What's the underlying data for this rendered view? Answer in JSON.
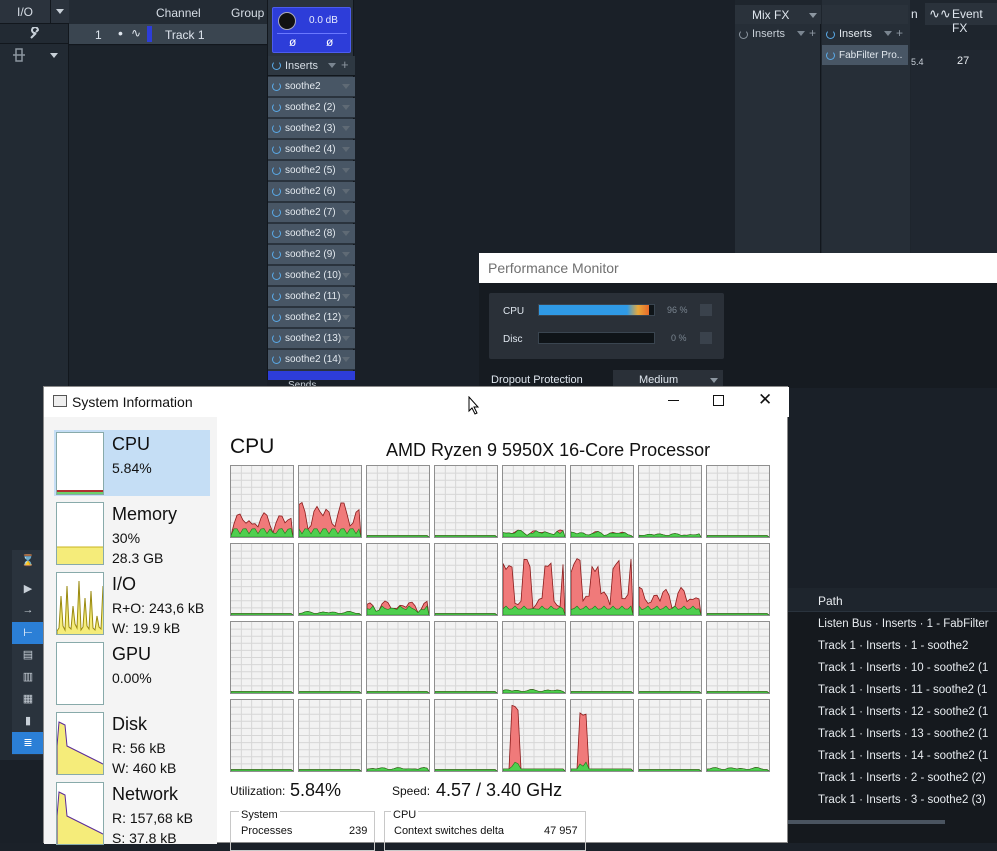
{
  "daw": {
    "io_label": "I/O",
    "channel_header": "Channel",
    "group_header": "Group",
    "track_number": "1",
    "track_name": "Track 1",
    "fader_level": "0.0 dB",
    "phase_left": "ø",
    "phase_right": "ø",
    "inserts_label": "Inserts",
    "sends_label": "Sends",
    "insert_slots": [
      "soothe2",
      "soothe2 (2)",
      "soothe2 (3)",
      "soothe2 (4)",
      "soothe2 (5)",
      "soothe2 (6)",
      "soothe2 (7)",
      "soothe2 (8)",
      "soothe2 (9)",
      "soothe2 (10)",
      "soothe2 (11)",
      "soothe2 (12)",
      "soothe2 (13)",
      "soothe2 (14)"
    ],
    "mix_fx_label": "Mix FX",
    "mix_inserts_label": "Inserts",
    "listen_inserts_label": "Inserts",
    "fabfilter_slot": "FabFilter Pro..",
    "event_fx_label": "Event FX",
    "tab_partial": "n",
    "ruler_a": "5.4",
    "ruler_b": "27",
    "path_header": "Path",
    "paths": [
      "Listen Bus · Inserts · 1 - FabFilter",
      "Track 1 · Inserts · 1 - soothe2",
      "Track 1 · Inserts · 10 - soothe2 (1",
      "Track 1 · Inserts · 11 - soothe2 (1",
      "Track 1 · Inserts · 12 - soothe2 (1",
      "Track 1 · Inserts · 13 - soothe2 (1",
      "Track 1 · Inserts · 14 - soothe2 (1",
      "Track 1 · Inserts · 2 - soothe2 (2)",
      "Track 1 · Inserts · 3 - soothe2 (3)"
    ]
  },
  "perf": {
    "title": "Performance Monitor",
    "cpu_label": "CPU",
    "cpu_pct": "96 %",
    "cpu_value": 0.96,
    "disc_label": "Disc",
    "disc_pct": "0 %",
    "disc_value": 0.0,
    "dropout_label": "Dropout Protection",
    "dropout_value": "Medium"
  },
  "sysinfo": {
    "title": "System Information",
    "heading": "CPU",
    "processor": "AMD Ryzen 9 5950X 16-Core Processor",
    "utilization_label": "Utilization:",
    "utilization_value": "5.84%",
    "speed_label": "Speed:",
    "speed_value": "4.57 / 3.40 GHz",
    "system_group": "System",
    "processes_label": "Processes",
    "processes_value": "239",
    "cpu_group": "CPU",
    "ctx_label": "Context switches delta",
    "ctx_value": "47 957",
    "sidebar": [
      {
        "title": "CPU",
        "line1": "5.84%",
        "line2": ""
      },
      {
        "title": "Memory",
        "line1": "30%",
        "line2": "28.3 GB"
      },
      {
        "title": "I/O",
        "line1": "R+O: 243,6 kB",
        "line2": "W: 19.9 kB"
      },
      {
        "title": "GPU",
        "line1": "0.00%",
        "line2": ""
      },
      {
        "title": "Disk",
        "line1": "R: 56 kB",
        "line2": "W: 460 kB"
      },
      {
        "title": "Network",
        "line1": "R: 157,68 kB",
        "line2": "S: 37.8 kB"
      }
    ]
  },
  "colors": {
    "accent": "#2d3dd9",
    "power": "#5aa9e6",
    "cpu_red": "#f07a7a",
    "cpu_green": "#4fcf4f",
    "mem_yellow": "#f5ec7a",
    "selected": "#c5def5"
  }
}
